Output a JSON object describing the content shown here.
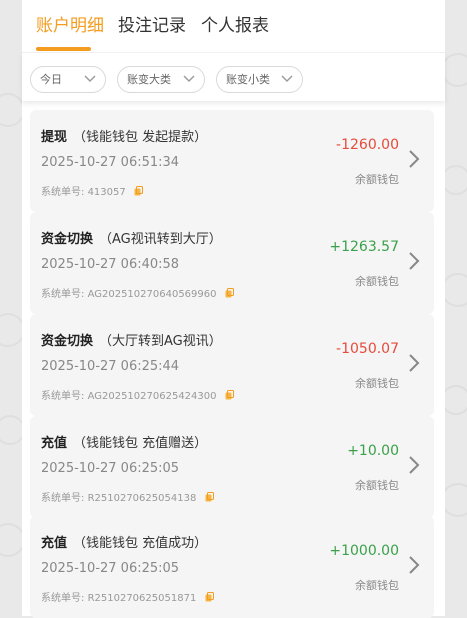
{
  "tabs": [
    {
      "label": "账户明细",
      "active": true
    },
    {
      "label": "投注记录",
      "active": false
    },
    {
      "label": "个人报表",
      "active": false
    }
  ],
  "filters": {
    "date": "今日",
    "category_major": "账变大类",
    "category_minor": "账变小类"
  },
  "order_prefix": "系统单号:",
  "records": [
    {
      "type": "提现",
      "desc": "（钱能钱包 发起提款）",
      "time": "2025-10-27 06:51:34",
      "order": "413057",
      "amount": "-1260.00",
      "sign": "neg",
      "wallet": "余额钱包"
    },
    {
      "type": "资金切换",
      "desc": "（AG视讯转到大厅）",
      "time": "2025-10-27 06:40:58",
      "order": "AG202510270640569960",
      "amount": "+1263.57",
      "sign": "pos",
      "wallet": "余额钱包"
    },
    {
      "type": "资金切换",
      "desc": "（大厅转到AG视讯）",
      "time": "2025-10-27 06:25:44",
      "order": "AG202510270625424300",
      "amount": "-1050.07",
      "sign": "neg",
      "wallet": "余额钱包"
    },
    {
      "type": "充值",
      "desc": "（钱能钱包 充值赠送）",
      "time": "2025-10-27 06:25:05",
      "order": "R2510270625054138",
      "amount": "+10.00",
      "sign": "pos",
      "wallet": "余额钱包"
    },
    {
      "type": "充值",
      "desc": "（钱能钱包 充值成功）",
      "time": "2025-10-27 06:25:05",
      "order": "R2510270625051871",
      "amount": "+1000.00",
      "sign": "pos",
      "wallet": "余额钱包"
    }
  ],
  "colors": {
    "accent": "#f39c1f",
    "negative": "#e64b3b",
    "positive": "#3aa14a",
    "card_bg": "#f5f5f5",
    "page_bg": "#e9e9e9"
  },
  "icons": {
    "chevron": "chevron-down-icon",
    "arrow": "chevron-right-icon",
    "copy": "copy-icon"
  }
}
